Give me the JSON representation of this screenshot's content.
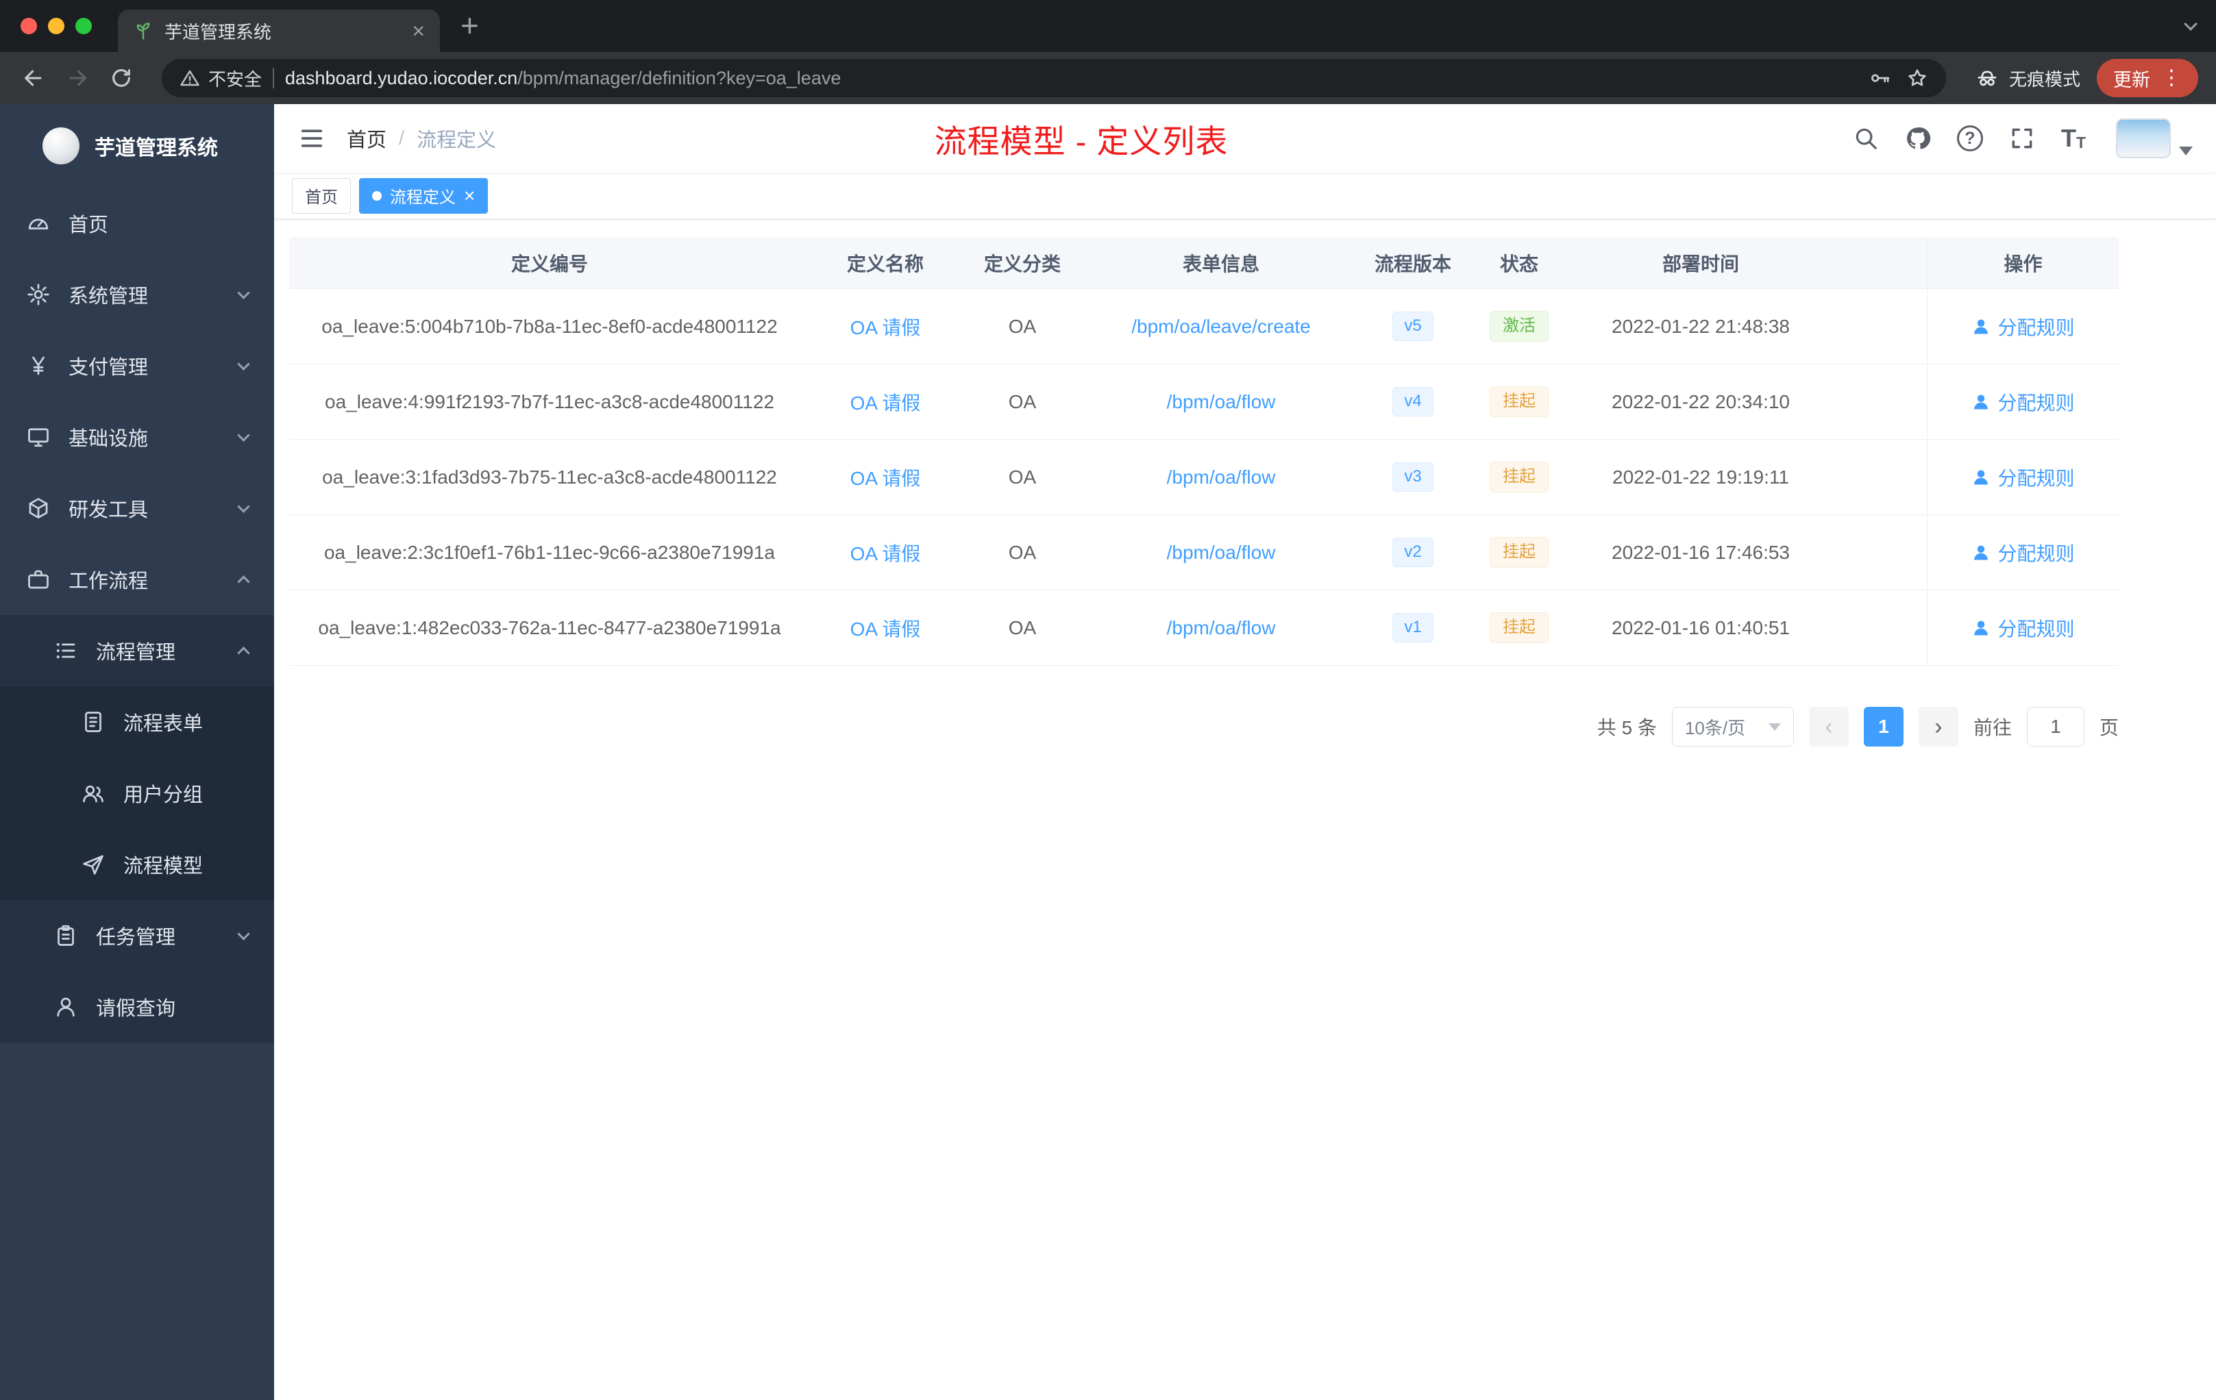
{
  "browser": {
    "tab_title": "芋道管理系统",
    "security_label": "不安全",
    "url_domain": "dashboard.yudao.iocoder.cn",
    "url_path": "/bpm/manager/definition?key=oa_leave",
    "incognito_label": "无痕模式",
    "update_label": "更新"
  },
  "icons": {
    "close": "×",
    "new_tab": "+",
    "kebab": "⋮",
    "help": "?",
    "font_big": "T",
    "font_small": "T",
    "prev": "‹",
    "next": "›"
  },
  "sidebar": {
    "brand": "芋道管理系统",
    "menu": [
      {
        "label": "首页"
      },
      {
        "label": "系统管理"
      },
      {
        "label": "支付管理"
      },
      {
        "label": "基础设施"
      },
      {
        "label": "研发工具"
      },
      {
        "label": "工作流程"
      },
      {
        "label": "流程管理"
      },
      {
        "label": "流程表单"
      },
      {
        "label": "用户分组"
      },
      {
        "label": "流程模型"
      },
      {
        "label": "任务管理"
      },
      {
        "label": "请假查询"
      }
    ]
  },
  "header": {
    "breadcrumb_home": "首页",
    "breadcrumb_sep": "/",
    "breadcrumb_current": "流程定义",
    "annotation": "流程模型 - 定义列表"
  },
  "tags": {
    "home": "首页",
    "active": "流程定义"
  },
  "table": {
    "columns": [
      "定义编号",
      "定义名称",
      "定义分类",
      "表单信息",
      "流程版本",
      "状态",
      "部署时间",
      "操作"
    ],
    "rows": [
      {
        "id": "oa_leave:5:004b710b-7b8a-11ec-8ef0-acde48001122",
        "name": "OA 请假",
        "category": "OA",
        "form": "/bpm/oa/leave/create",
        "version": "v5",
        "status": "激活",
        "time": "2022-01-22 21:48:38",
        "action": "分配规则"
      },
      {
        "id": "oa_leave:4:991f2193-7b7f-11ec-a3c8-acde48001122",
        "name": "OA 请假",
        "category": "OA",
        "form": "/bpm/oa/flow",
        "version": "v4",
        "status": "挂起",
        "time": "2022-01-22 20:34:10",
        "action": "分配规则"
      },
      {
        "id": "oa_leave:3:1fad3d93-7b75-11ec-a3c8-acde48001122",
        "name": "OA 请假",
        "category": "OA",
        "form": "/bpm/oa/flow",
        "version": "v3",
        "status": "挂起",
        "time": "2022-01-22 19:19:11",
        "action": "分配规则"
      },
      {
        "id": "oa_leave:2:3c1f0ef1-76b1-11ec-9c66-a2380e71991a",
        "name": "OA 请假",
        "category": "OA",
        "form": "/bpm/oa/flow",
        "version": "v2",
        "status": "挂起",
        "time": "2022-01-16 17:46:53",
        "action": "分配规则"
      },
      {
        "id": "oa_leave:1:482ec033-762a-11ec-8477-a2380e71991a",
        "name": "OA 请假",
        "category": "OA",
        "form": "/bpm/oa/flow",
        "version": "v1",
        "status": "挂起",
        "time": "2022-01-16 01:40:51",
        "action": "分配规则"
      }
    ]
  },
  "pagination": {
    "total": "共 5 条",
    "page_size": "10条/页",
    "page": "1",
    "goto_label": "前往",
    "goto_value": "1",
    "goto_unit": "页"
  },
  "colors": {
    "accent": "#409eff",
    "annotation_red": "#f11c1c",
    "status_active": "#67c23a",
    "status_suspended": "#e6a23c",
    "sidebar_bg": "#2f3c50"
  }
}
